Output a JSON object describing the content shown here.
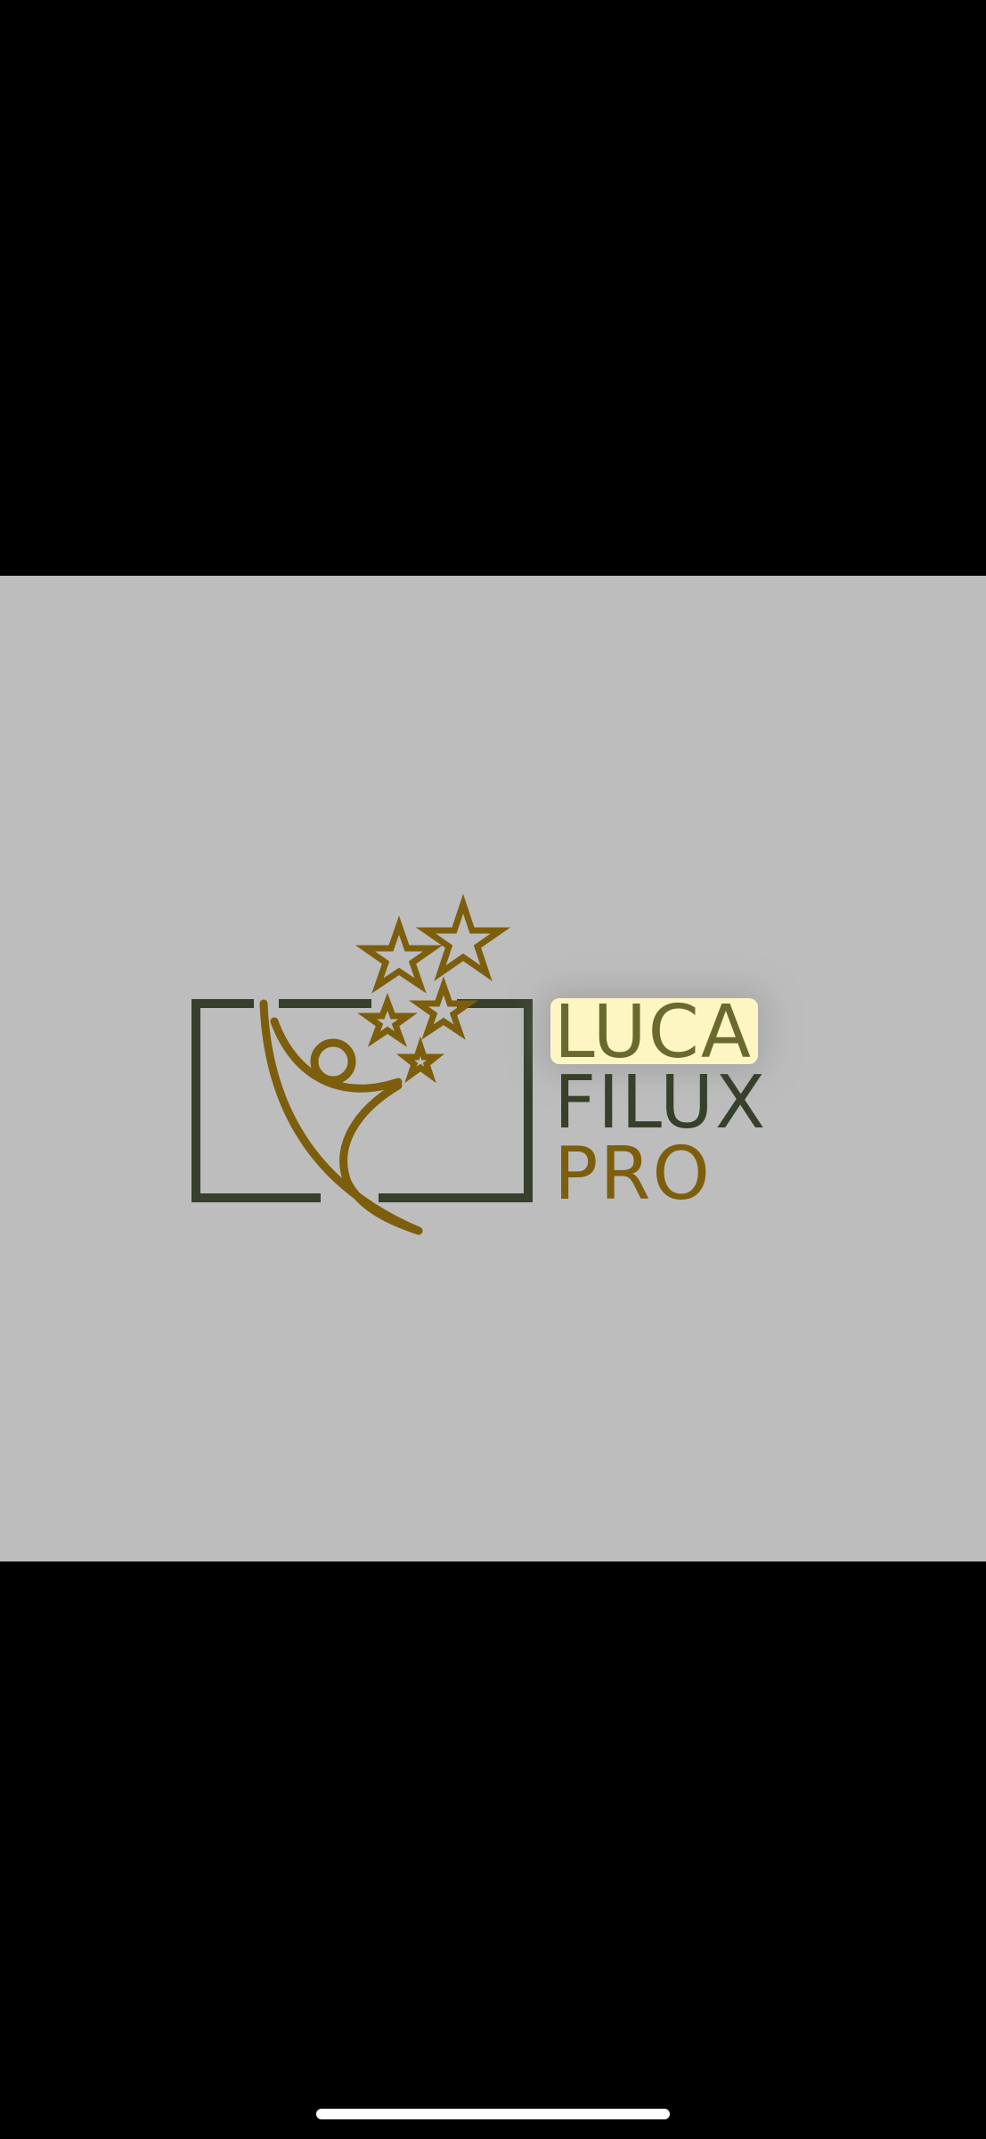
{
  "viewer": {
    "background": "#000000"
  },
  "image": {
    "background": "#bdbdbd",
    "logo": {
      "line1": "LUCA",
      "line2": "FILUX",
      "line3": "PRO",
      "colors": {
        "frame": "#37402a",
        "figure": "#7d5e0c",
        "line1_text": "#6b6a2e",
        "line1_highlight": "#fdf6c3",
        "line2_text": "#37402a",
        "line3_text": "#7d5e0c"
      },
      "icons": [
        "camera-frame-icon",
        "star-person-icon",
        "star-icon"
      ]
    }
  },
  "system": {
    "home_indicator": "home-indicator-bar"
  }
}
